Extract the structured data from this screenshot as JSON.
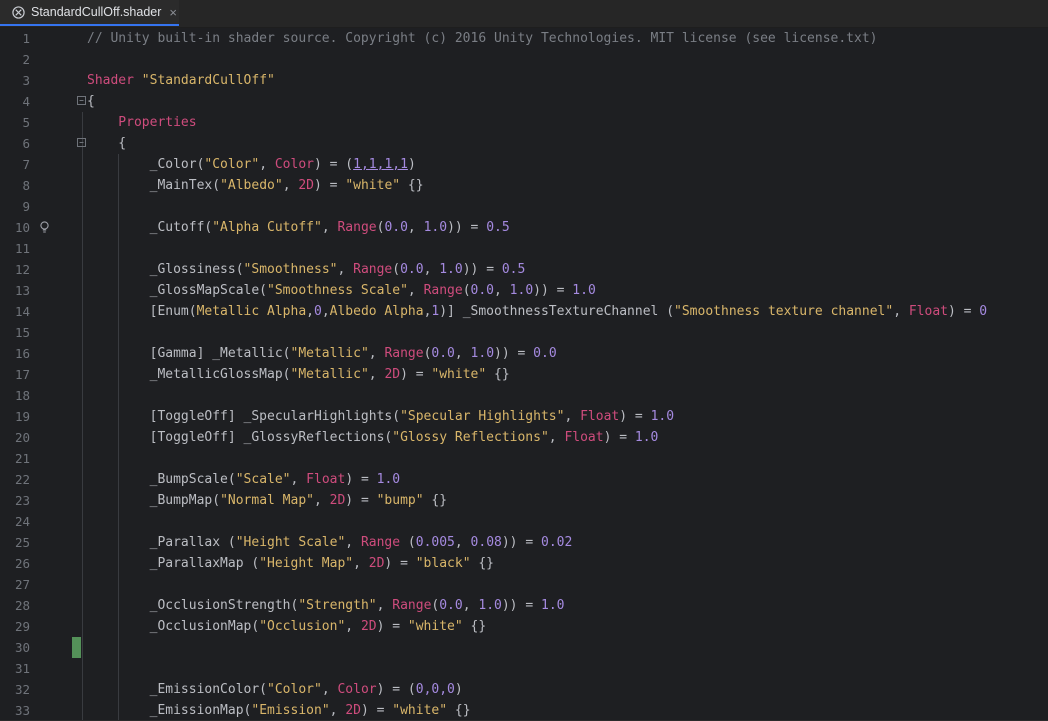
{
  "tab": {
    "label": "StandardCullOff.shader",
    "close_glyph": "×",
    "icon": "unity-icon"
  },
  "editor": {
    "lines": [
      {
        "no": "1",
        "t": [
          [
            "// Unity built-in shader source. Copyright (c) 2016 Unity Technologies. MIT license (see license.txt)",
            "cm"
          ]
        ]
      },
      {
        "no": "2",
        "t": []
      },
      {
        "no": "3",
        "t": [
          [
            "Shader ",
            "kw"
          ],
          [
            "\"StandardCullOff\"",
            "str"
          ]
        ]
      },
      {
        "no": "4",
        "t": [
          [
            "{",
            "pn"
          ]
        ]
      },
      {
        "no": "5",
        "t": [
          [
            "    Properties",
            "kw"
          ]
        ]
      },
      {
        "no": "6",
        "t": [
          [
            "    {",
            "pn"
          ]
        ]
      },
      {
        "no": "7",
        "t": [
          [
            "        _Color(",
            "pn"
          ],
          [
            "\"Color\"",
            "str"
          ],
          [
            ", ",
            "pn"
          ],
          [
            "Color",
            "kw"
          ],
          [
            ") = (",
            "pn"
          ],
          [
            "1,1,1,1",
            "num ul"
          ],
          [
            ")",
            "pn"
          ]
        ]
      },
      {
        "no": "8",
        "t": [
          [
            "        _MainTex(",
            "pn"
          ],
          [
            "\"Albedo\"",
            "str"
          ],
          [
            ", ",
            "pn"
          ],
          [
            "2D",
            "kw"
          ],
          [
            ") = ",
            "pn"
          ],
          [
            "\"white\"",
            "str"
          ],
          [
            " {}",
            "pn"
          ]
        ]
      },
      {
        "no": "9",
        "t": []
      },
      {
        "no": "10",
        "t": [
          [
            "        _Cutoff(",
            "pn"
          ],
          [
            "\"Alpha Cutoff\"",
            "str"
          ],
          [
            ", ",
            "pn"
          ],
          [
            "Range",
            "kw"
          ],
          [
            "(",
            "pn"
          ],
          [
            "0.0",
            "num"
          ],
          [
            ", ",
            "pn"
          ],
          [
            "1.0",
            "num"
          ],
          [
            ")) = ",
            "pn"
          ],
          [
            "0.5",
            "num"
          ]
        ]
      },
      {
        "no": "11",
        "t": []
      },
      {
        "no": "12",
        "t": [
          [
            "        _Glossiness(",
            "pn"
          ],
          [
            "\"Smoothness\"",
            "str"
          ],
          [
            ", ",
            "pn"
          ],
          [
            "Range",
            "kw"
          ],
          [
            "(",
            "pn"
          ],
          [
            "0.0",
            "num"
          ],
          [
            ", ",
            "pn"
          ],
          [
            "1.0",
            "num"
          ],
          [
            ")) = ",
            "pn"
          ],
          [
            "0.5",
            "num"
          ]
        ]
      },
      {
        "no": "13",
        "t": [
          [
            "        _GlossMapScale(",
            "pn"
          ],
          [
            "\"Smoothness Scale\"",
            "str"
          ],
          [
            ", ",
            "pn"
          ],
          [
            "Range",
            "kw"
          ],
          [
            "(",
            "pn"
          ],
          [
            "0.0",
            "num"
          ],
          [
            ", ",
            "pn"
          ],
          [
            "1.0",
            "num"
          ],
          [
            ")) = ",
            "pn"
          ],
          [
            "1.0",
            "num"
          ]
        ]
      },
      {
        "no": "14",
        "t": [
          [
            "        [Enum(",
            "pn"
          ],
          [
            "Metallic Alpha",
            "str"
          ],
          [
            ",",
            "pn"
          ],
          [
            "0",
            "num"
          ],
          [
            ",",
            "pn"
          ],
          [
            "Albedo Alpha",
            "str"
          ],
          [
            ",",
            "pn"
          ],
          [
            "1",
            "num"
          ],
          [
            ")] _SmoothnessTextureChannel (",
            "pn"
          ],
          [
            "\"Smoothness texture channel\"",
            "str"
          ],
          [
            ", ",
            "pn"
          ],
          [
            "Float",
            "kw"
          ],
          [
            ") = ",
            "pn"
          ],
          [
            "0",
            "num"
          ]
        ]
      },
      {
        "no": "15",
        "t": []
      },
      {
        "no": "16",
        "t": [
          [
            "        [Gamma] _Metallic(",
            "pn"
          ],
          [
            "\"Metallic\"",
            "str"
          ],
          [
            ", ",
            "pn"
          ],
          [
            "Range",
            "kw"
          ],
          [
            "(",
            "pn"
          ],
          [
            "0.0",
            "num"
          ],
          [
            ", ",
            "pn"
          ],
          [
            "1.0",
            "num"
          ],
          [
            ")) = ",
            "pn"
          ],
          [
            "0.0",
            "num"
          ]
        ]
      },
      {
        "no": "17",
        "t": [
          [
            "        _MetallicGlossMap(",
            "pn"
          ],
          [
            "\"Metallic\"",
            "str"
          ],
          [
            ", ",
            "pn"
          ],
          [
            "2D",
            "kw"
          ],
          [
            ") = ",
            "pn"
          ],
          [
            "\"white\"",
            "str"
          ],
          [
            " {}",
            "pn"
          ]
        ]
      },
      {
        "no": "18",
        "t": []
      },
      {
        "no": "19",
        "t": [
          [
            "        [ToggleOff] _SpecularHighlights(",
            "pn"
          ],
          [
            "\"Specular Highlights\"",
            "str"
          ],
          [
            ", ",
            "pn"
          ],
          [
            "Float",
            "kw"
          ],
          [
            ") = ",
            "pn"
          ],
          [
            "1.0",
            "num"
          ]
        ]
      },
      {
        "no": "20",
        "t": [
          [
            "        [ToggleOff] _GlossyReflections(",
            "pn"
          ],
          [
            "\"Glossy Reflections\"",
            "str"
          ],
          [
            ", ",
            "pn"
          ],
          [
            "Float",
            "kw"
          ],
          [
            ") = ",
            "pn"
          ],
          [
            "1.0",
            "num"
          ]
        ]
      },
      {
        "no": "21",
        "t": []
      },
      {
        "no": "22",
        "t": [
          [
            "        _BumpScale(",
            "pn"
          ],
          [
            "\"Scale\"",
            "str"
          ],
          [
            ", ",
            "pn"
          ],
          [
            "Float",
            "kw"
          ],
          [
            ") = ",
            "pn"
          ],
          [
            "1.0",
            "num"
          ]
        ]
      },
      {
        "no": "23",
        "t": [
          [
            "        _BumpMap(",
            "pn"
          ],
          [
            "\"Normal Map\"",
            "str"
          ],
          [
            ", ",
            "pn"
          ],
          [
            "2D",
            "kw"
          ],
          [
            ") = ",
            "pn"
          ],
          [
            "\"bump\"",
            "str"
          ],
          [
            " {}",
            "pn"
          ]
        ]
      },
      {
        "no": "24",
        "t": []
      },
      {
        "no": "25",
        "t": [
          [
            "        _Parallax (",
            "pn"
          ],
          [
            "\"Height Scale\"",
            "str"
          ],
          [
            ", ",
            "pn"
          ],
          [
            "Range",
            "kw"
          ],
          [
            " (",
            "pn"
          ],
          [
            "0.005",
            "num"
          ],
          [
            ", ",
            "pn"
          ],
          [
            "0.08",
            "num"
          ],
          [
            ")) = ",
            "pn"
          ],
          [
            "0.02",
            "num"
          ]
        ]
      },
      {
        "no": "26",
        "t": [
          [
            "        _ParallaxMap (",
            "pn"
          ],
          [
            "\"Height Map\"",
            "str"
          ],
          [
            ", ",
            "pn"
          ],
          [
            "2D",
            "kw"
          ],
          [
            ") = ",
            "pn"
          ],
          [
            "\"black\"",
            "str"
          ],
          [
            " {}",
            "pn"
          ]
        ]
      },
      {
        "no": "27",
        "t": []
      },
      {
        "no": "28",
        "t": [
          [
            "        _OcclusionStrength(",
            "pn"
          ],
          [
            "\"Strength\"",
            "str"
          ],
          [
            ", ",
            "pn"
          ],
          [
            "Range",
            "kw"
          ],
          [
            "(",
            "pn"
          ],
          [
            "0.0",
            "num"
          ],
          [
            ", ",
            "pn"
          ],
          [
            "1.0",
            "num"
          ],
          [
            ")) = ",
            "pn"
          ],
          [
            "1.0",
            "num"
          ]
        ]
      },
      {
        "no": "29",
        "t": [
          [
            "        _OcclusionMap(",
            "pn"
          ],
          [
            "\"Occlusion\"",
            "str"
          ],
          [
            ", ",
            "pn"
          ],
          [
            "2D",
            "kw"
          ],
          [
            ") = ",
            "pn"
          ],
          [
            "\"white\"",
            "str"
          ],
          [
            " {}",
            "pn"
          ]
        ]
      },
      {
        "no": "30",
        "t": []
      },
      {
        "no": "31",
        "t": []
      },
      {
        "no": "32",
        "t": [
          [
            "        _EmissionColor(",
            "pn"
          ],
          [
            "\"Color\"",
            "str"
          ],
          [
            ", ",
            "pn"
          ],
          [
            "Color",
            "kw"
          ],
          [
            ") = (",
            "pn"
          ],
          [
            "0,0,0",
            "num"
          ],
          [
            ")",
            "pn"
          ]
        ]
      },
      {
        "no": "33",
        "t": [
          [
            "        _EmissionMap(",
            "pn"
          ],
          [
            "\"Emission\"",
            "str"
          ],
          [
            ", ",
            "pn"
          ],
          [
            "2D",
            "kw"
          ],
          [
            ") = ",
            "pn"
          ],
          [
            "\"white\"",
            "str"
          ],
          [
            " {}",
            "pn"
          ]
        ]
      }
    ],
    "fold_lines": [
      "4",
      "6"
    ],
    "bulb_line": "10",
    "changed_line": "30"
  },
  "colors": {
    "keyword": "#cf4c7d",
    "string": "#d9b66a",
    "number": "#a58ae0",
    "comment": "#7a7e85",
    "text": "#bcbec4",
    "change_marker": "#549159"
  }
}
